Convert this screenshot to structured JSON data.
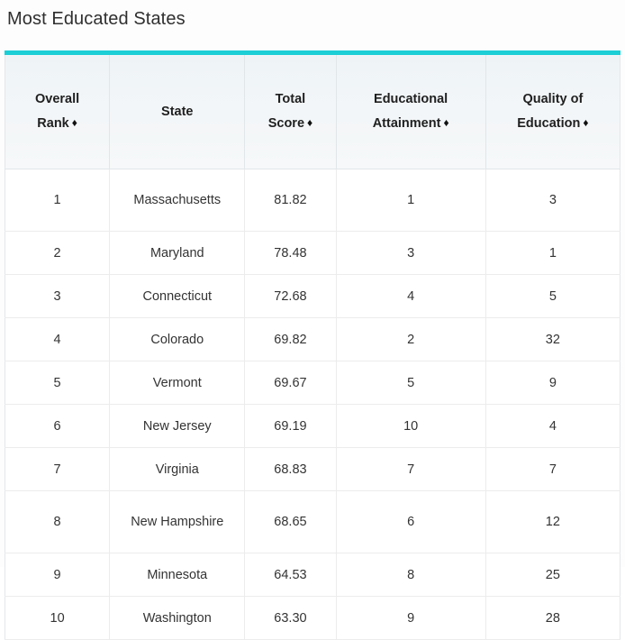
{
  "page": {
    "title": "Most Educated States",
    "accent_color": "#1ccfd6",
    "header_bg": "#f1f5f7",
    "border_color": "#ececec",
    "text_color": "#333333"
  },
  "table": {
    "sort_icon": "♦",
    "columns": [
      {
        "key": "rank",
        "line1": "Overall",
        "line2": "Rank",
        "sortable": true
      },
      {
        "key": "state",
        "line1": "",
        "line2": "State",
        "sortable": false
      },
      {
        "key": "score",
        "line1": "Total",
        "line2": "Score",
        "sortable": true
      },
      {
        "key": "attain",
        "line1": "Educational",
        "line2": "Attainment",
        "sortable": true
      },
      {
        "key": "qual",
        "line1": "Quality of",
        "line2": "Education",
        "sortable": true
      }
    ],
    "rows": [
      {
        "rank": "1",
        "state": "Massachusetts",
        "score": "81.82",
        "attain": "1",
        "qual": "3"
      },
      {
        "rank": "2",
        "state": "Maryland",
        "score": "78.48",
        "attain": "3",
        "qual": "1"
      },
      {
        "rank": "3",
        "state": "Connecticut",
        "score": "72.68",
        "attain": "4",
        "qual": "5"
      },
      {
        "rank": "4",
        "state": "Colorado",
        "score": "69.82",
        "attain": "2",
        "qual": "32"
      },
      {
        "rank": "5",
        "state": "Vermont",
        "score": "69.67",
        "attain": "5",
        "qual": "9"
      },
      {
        "rank": "6",
        "state": "New Jersey",
        "score": "69.19",
        "attain": "10",
        "qual": "4"
      },
      {
        "rank": "7",
        "state": "Virginia",
        "score": "68.83",
        "attain": "7",
        "qual": "7"
      },
      {
        "rank": "8",
        "state": "New Hampshire",
        "score": "68.65",
        "attain": "6",
        "qual": "12"
      },
      {
        "rank": "9",
        "state": "Minnesota",
        "score": "64.53",
        "attain": "8",
        "qual": "25"
      },
      {
        "rank": "10",
        "state": "Washington",
        "score": "63.30",
        "attain": "9",
        "qual": "28"
      }
    ]
  }
}
